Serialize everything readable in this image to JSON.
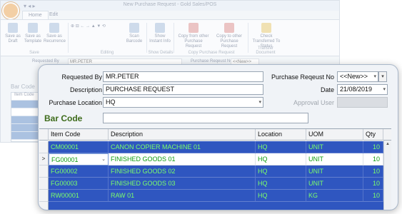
{
  "bg": {
    "window_title": "New Purchase Request - Gold Sales/POS",
    "tabs": [
      "Home",
      "Edit"
    ],
    "ribbon_buttons": [
      "Save as Draft",
      "Save as Template",
      "Save as Recurrence",
      "Scan Barcode",
      "Show Instant Info",
      "Copy from other Purchase Request",
      "Copy to other Purchase Request",
      "Check Transferred To Status"
    ],
    "ribbon_groups": [
      "Save",
      "Editing",
      "Show Details",
      "Copy Purchase Request",
      "Transfer Document"
    ],
    "requested_by_label": "Requested By",
    "requested_by_value": "MR.PETER",
    "purchase_request_no_label": "Purchase Reqeust No",
    "purchase_request_no_value": "<<New>>",
    "barcode_label": "Bar Code",
    "item_code_header": "Item Code"
  },
  "form": {
    "requested_by_label": "Requested By",
    "requested_by_value": "MR.PETER",
    "description_label": "Description",
    "description_value": "PURCHASE REQUEST",
    "purchase_location_label": "Purchase Location",
    "purchase_location_value": "HQ",
    "purchase_request_no_label": "Purchase Reqeust No",
    "purchase_request_no_value": "<<New>>",
    "date_label": "Date",
    "date_value": "21/08/2019",
    "approval_user_label": "Approval User",
    "approval_user_value": "",
    "barcode_label": "Bar Code",
    "barcode_value": ""
  },
  "grid": {
    "columns": [
      "Item Code",
      "Description",
      "Location",
      "UOM",
      "Qty"
    ],
    "rows": [
      [
        "CM00001",
        "CANON COPIER MACHINE 01",
        "HQ",
        "UNIT",
        "10"
      ],
      [
        "FG00001",
        "FINISHED GOODS 01",
        "HQ",
        "UNIT",
        "10"
      ],
      [
        "FG00002",
        "FINISHED GOODS 02",
        "HQ",
        "UNIT",
        "10"
      ],
      [
        "FG00003",
        "FINISHED GOODS 03",
        "HQ",
        "UNIT",
        "10"
      ],
      [
        "RW00001",
        "RAW 01",
        "HQ",
        "KG",
        "10"
      ]
    ],
    "current_row_marker": ">"
  },
  "colors": {
    "selected_row": "#2f56c0",
    "cell_text_selected": "#7cff6a",
    "cell_text_current": "#0d9b0d",
    "barcode_label": "#3d6b1a"
  }
}
